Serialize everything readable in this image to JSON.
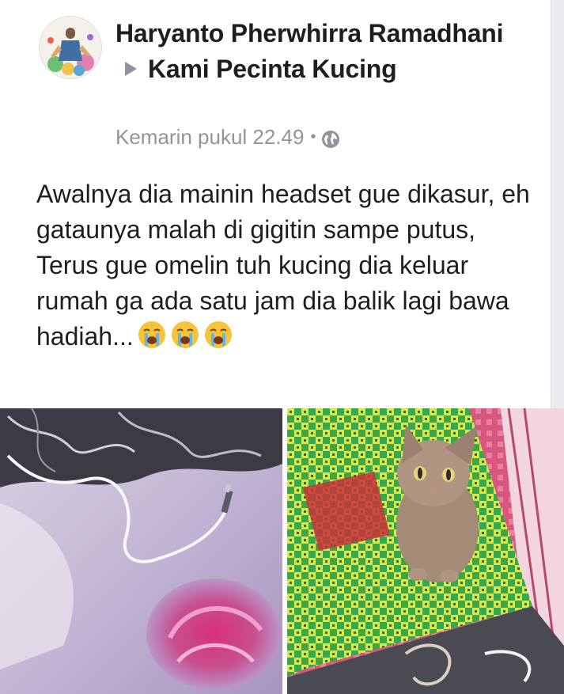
{
  "post": {
    "author": "Haryanto Pherwhirra Ramadhani",
    "group": "Kami Pecinta Kucing",
    "timestamp": "Kemarin pukul 22.49",
    "separator": "•",
    "privacy_icon": "globe-icon",
    "text_lines": [
      "Awalnya dia mainin headset gue dikasur, eh gataunya malah di gigitin sampe putus,",
      "Terus gue omelin tuh kucing dia keluar rumah ga ada satu jam dia balik lagi bawa hadiah..."
    ],
    "emoji_icon": "loudly-crying-face-icon",
    "emoji_count": 3
  },
  "photos": [
    {
      "name": "broken-headset-photo"
    },
    {
      "name": "cat-photo"
    }
  ],
  "colors": {
    "text": "#1c1e21",
    "meta": "#90949c",
    "arrow": "#8d949e",
    "background": "#e9ebee"
  }
}
